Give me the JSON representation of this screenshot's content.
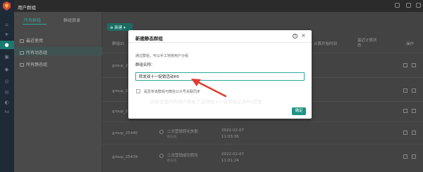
{
  "window": {
    "title": "用户群组"
  },
  "sidebar": {
    "icons": [
      "logo-icon",
      "home-icon",
      "send-icon",
      "user-icon",
      "group-icon",
      "tag-icon",
      "chat-icon",
      "wechat-icon",
      "ad-icon"
    ],
    "ad_label": "Ad"
  },
  "leftnav": {
    "tabs": [
      {
        "label": "所有群组"
      },
      {
        "label": "群组目录"
      }
    ],
    "items": [
      {
        "label": "最近使用"
      },
      {
        "label": "所有动态组"
      },
      {
        "label": "所有静态组"
      }
    ]
  },
  "toolbar": {
    "new_label": "新建"
  },
  "table": {
    "headers": [
      "群组ID",
      "计算开始时间",
      "最近计算状态",
      "操作"
    ],
    "rows": [
      {
        "id": "group_2"
      },
      {
        "id": "group_2"
      },
      {
        "id": "group_2"
      },
      {
        "id": "group_25440",
        "name": "二次营销转化失败",
        "type": "静态组",
        "date": "2022-02-07",
        "time": "11:03:36"
      },
      {
        "id": "group_25439",
        "name": "二次营销成功转化",
        "type": "静态组",
        "date": "2022-02-07",
        "time": "11:01:24"
      }
    ]
  },
  "dialog": {
    "title": "新建静态群组",
    "help": "?",
    "close": "×",
    "description": "通过群组，可以手工地将用户分组",
    "name_label": "群组名称：",
    "name_value": "转发双十一促销活动H5",
    "sync_label": "是否将该群组与微信公众号关联同步",
    "ok_label": "确定"
  },
  "annotation": {
    "text": "此标签组中的用户转发了品牌双十一促销易企秀H5页面",
    "color": "#e03c31"
  },
  "colors": {
    "accent": "#1f9284",
    "sidebar": "#1f2a37"
  }
}
